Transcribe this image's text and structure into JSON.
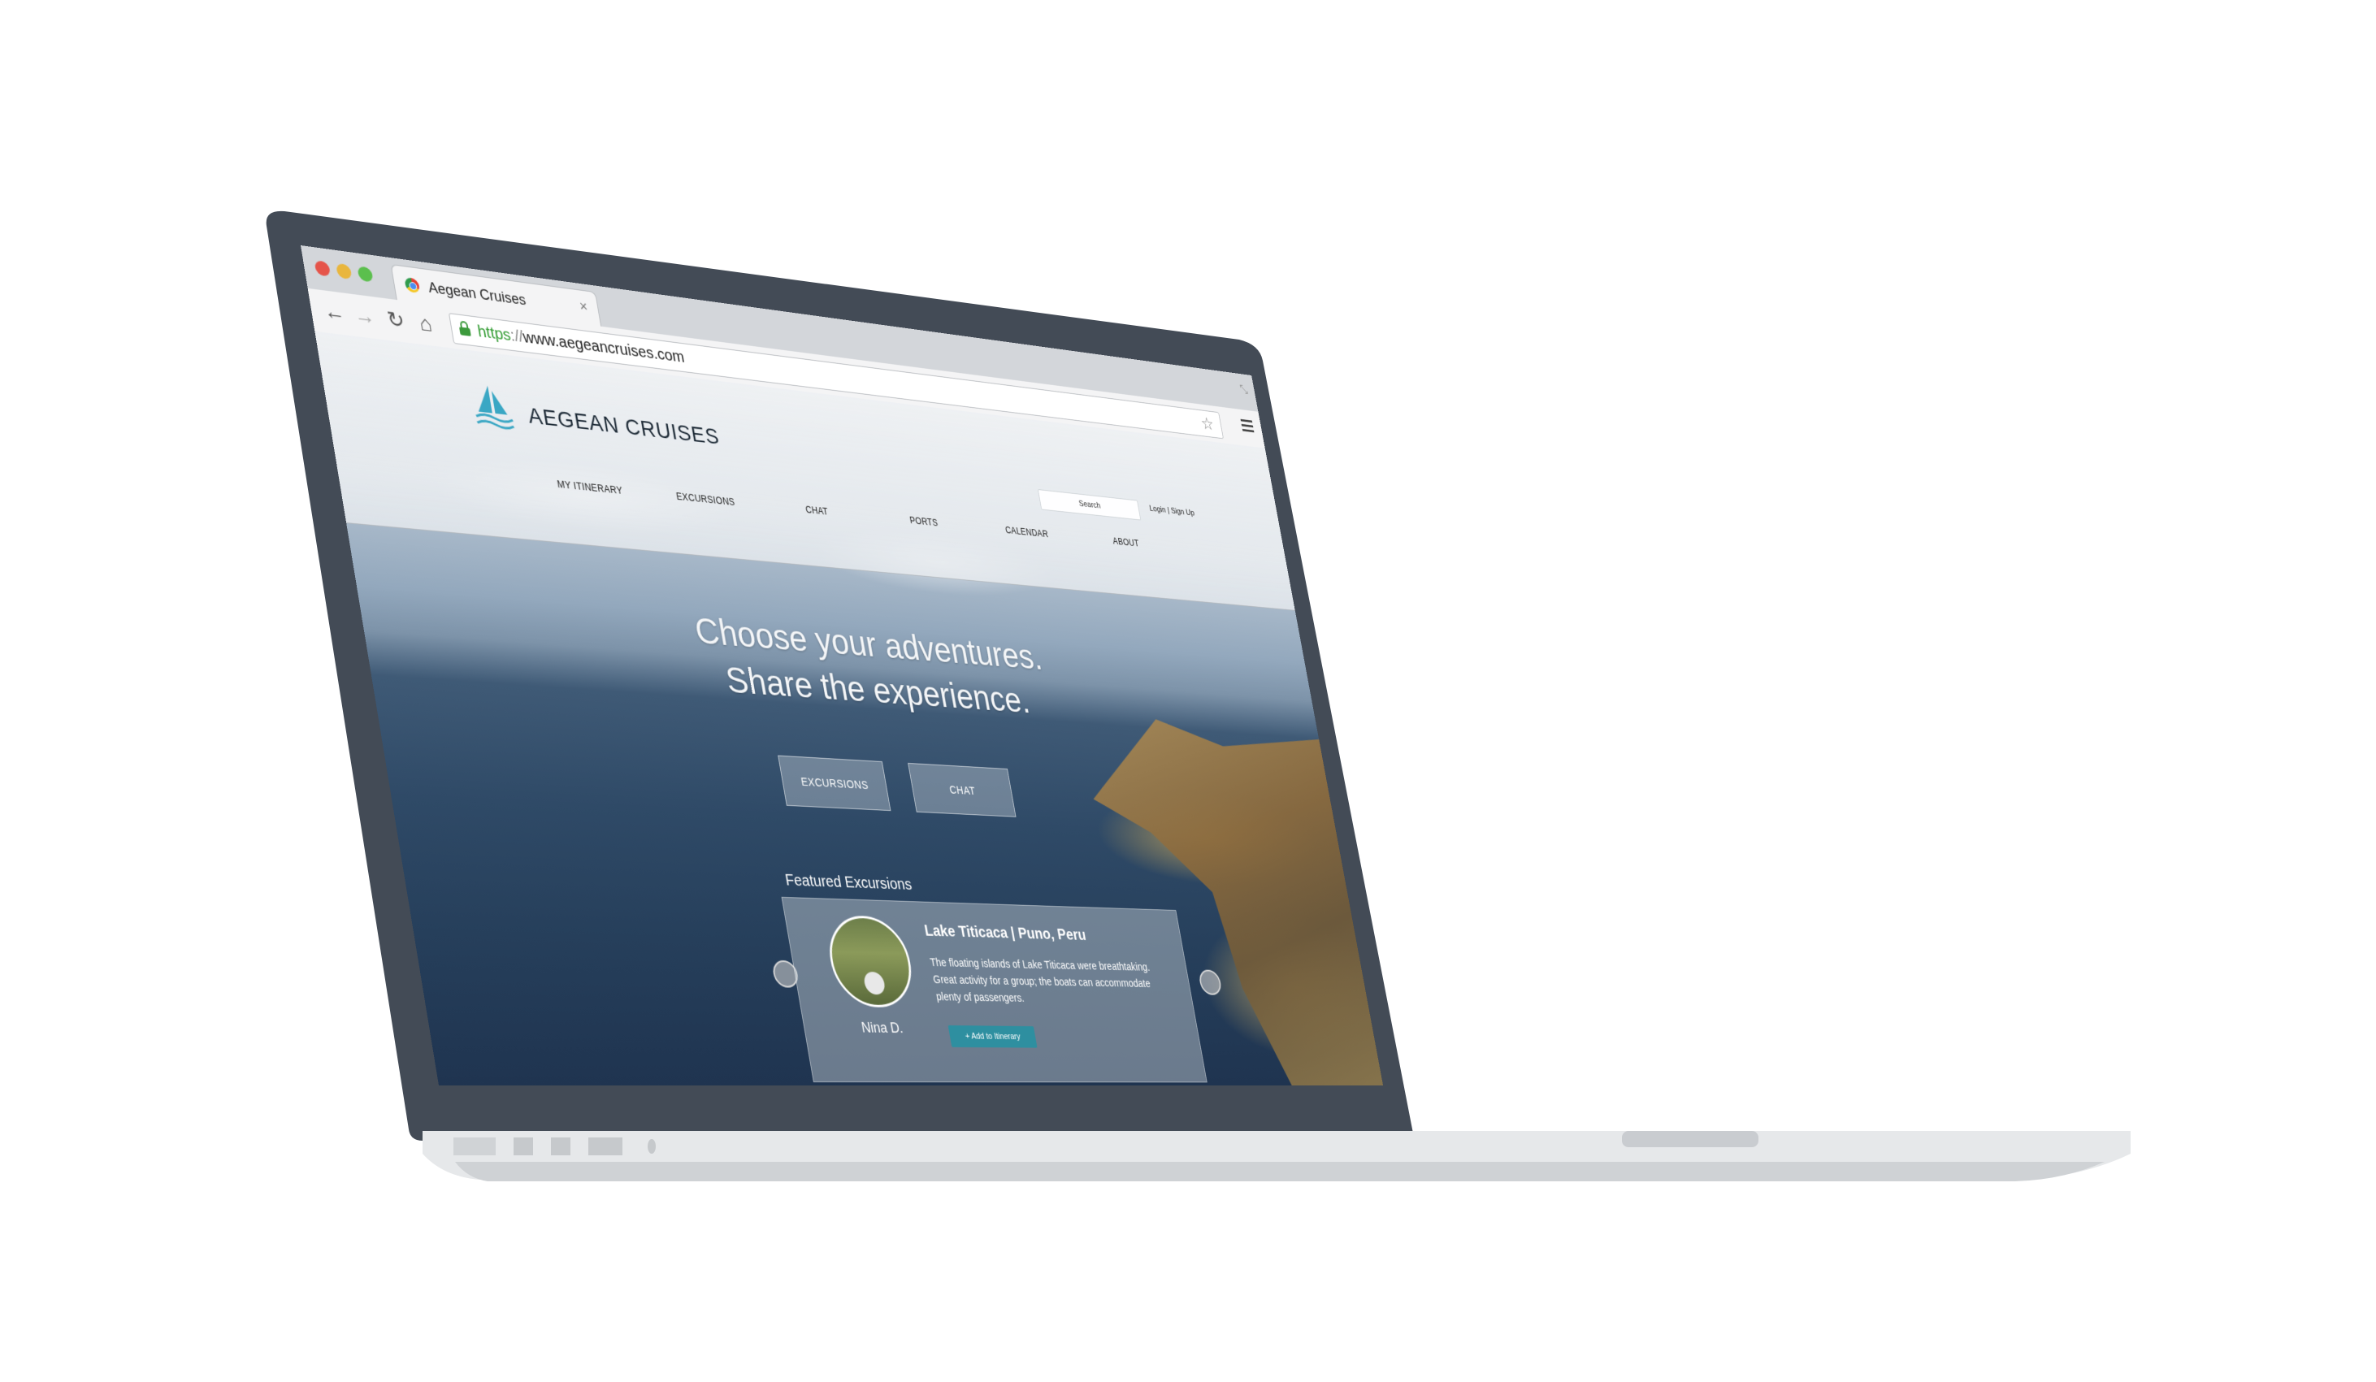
{
  "browser": {
    "tab_title": "Aegean Cruises",
    "tab_close": "×",
    "url_scheme": "https",
    "url_separator": "://",
    "url_rest": "www.aegeancruises.com",
    "back_icon": "back-arrow-icon",
    "forward_icon": "forward-arrow-icon",
    "reload_icon": "reload-icon",
    "home_icon": "home-icon"
  },
  "site": {
    "brand": "AEGEAN CRUISES",
    "nav": [
      "MY ITINERARY",
      "EXCURSIONS",
      "CHAT",
      "PORTS",
      "CALENDAR",
      "ABOUT"
    ],
    "search_placeholder": "Search",
    "login": "Login | Sign Up"
  },
  "hero": {
    "line1": "Choose your adventures.",
    "line2": "Share the experience.",
    "cta_excursions": "EXCURSIONS",
    "cta_chat": "CHAT"
  },
  "featured": {
    "label": "Featured Excursions",
    "card": {
      "title": "Lake Titicaca | Puno, Peru",
      "body": "The floating islands of Lake Titicaca were breathtaking. Great activity for a group; the boats can accommodate plenty of passengers.",
      "author": "Nina D.",
      "button": "+ Add to Itinerary"
    }
  },
  "colors": {
    "accent": "#2e8fa0",
    "laptop_bezel": "#434b56",
    "laptop_base": "#e6e8ea",
    "logo": "#3aa7c4"
  }
}
